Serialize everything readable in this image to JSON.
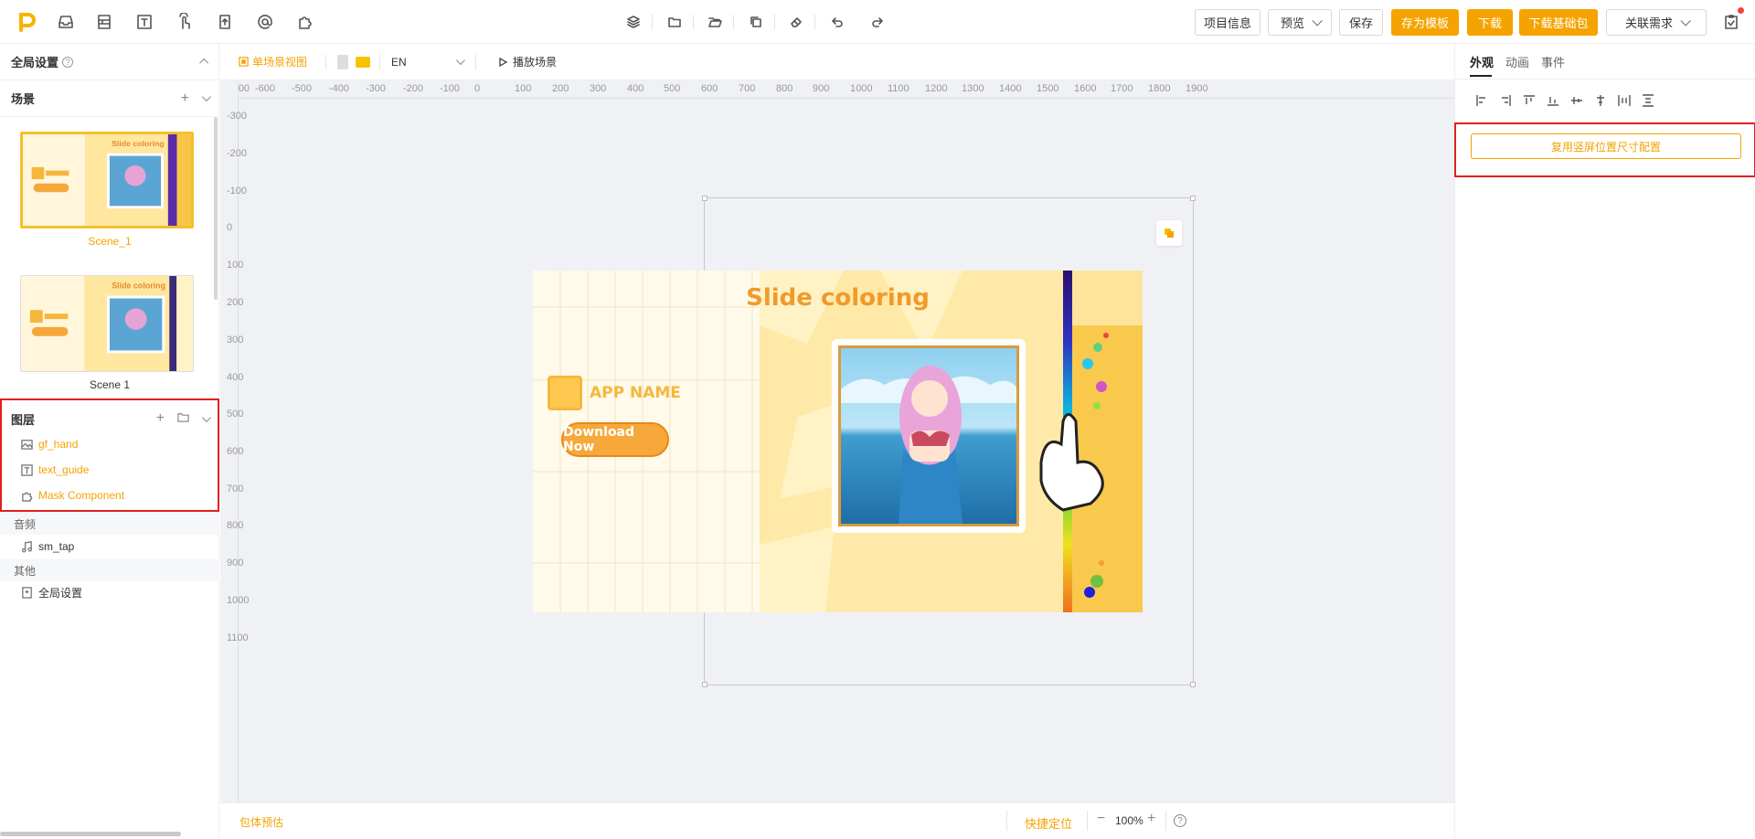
{
  "toolbar": {
    "project_info": "项目信息",
    "preview": "预览",
    "save": "保存",
    "save_template": "存为模板",
    "download": "下载",
    "download_base": "下载基础包",
    "related_requirements": "关联需求"
  },
  "left": {
    "global_settings_title": "全局设置",
    "scenes_title": "场景",
    "scenes": [
      {
        "label": "Scene_1",
        "active": true
      },
      {
        "label": "Scene 1",
        "active": false
      }
    ],
    "layers_title": "图层",
    "layers": [
      {
        "label": "gf_hand",
        "icon": "image-icon"
      },
      {
        "label": "text_guide",
        "icon": "text-icon"
      },
      {
        "label": "Mask Component",
        "icon": "component-icon"
      }
    ],
    "audio_title": "音频",
    "audio_items": [
      {
        "label": "sm_tap",
        "icon": "music-note-icon"
      }
    ],
    "other_title": "其他",
    "other_items": [
      {
        "label": "全局设置",
        "icon": "settings-doc-icon"
      }
    ]
  },
  "canvasbar": {
    "single_scene_view": "单场景视图",
    "language": "EN",
    "play_scene": "播放场景"
  },
  "rulers": {
    "h_ticks": [
      -400,
      -600,
      -500,
      -400,
      -300,
      -200,
      -100,
      0,
      100,
      200,
      300,
      400,
      500,
      600,
      700,
      800,
      900,
      1000,
      1100,
      1200,
      1300,
      1400,
      1500,
      1600,
      1700,
      1800,
      1900
    ],
    "v_ticks": [
      -300,
      -200,
      -100,
      0,
      100,
      200,
      300,
      400,
      500,
      600,
      700,
      800,
      900,
      1000,
      1100
    ]
  },
  "preview": {
    "title": "Slide coloring",
    "app_name": "APP NAME",
    "download_button": "Download Now"
  },
  "bottombar": {
    "package_estimate": "包体预估",
    "quick_locate": "快捷定位",
    "zoom": "100%",
    "help": "?"
  },
  "right": {
    "tabs": [
      "外观",
      "动画",
      "事件"
    ],
    "active_tab": "外观",
    "reuse_button": "复用竖屏位置尺寸配置"
  },
  "colors": {
    "accent": "#f5a300",
    "highlight_box": "#e02020"
  }
}
